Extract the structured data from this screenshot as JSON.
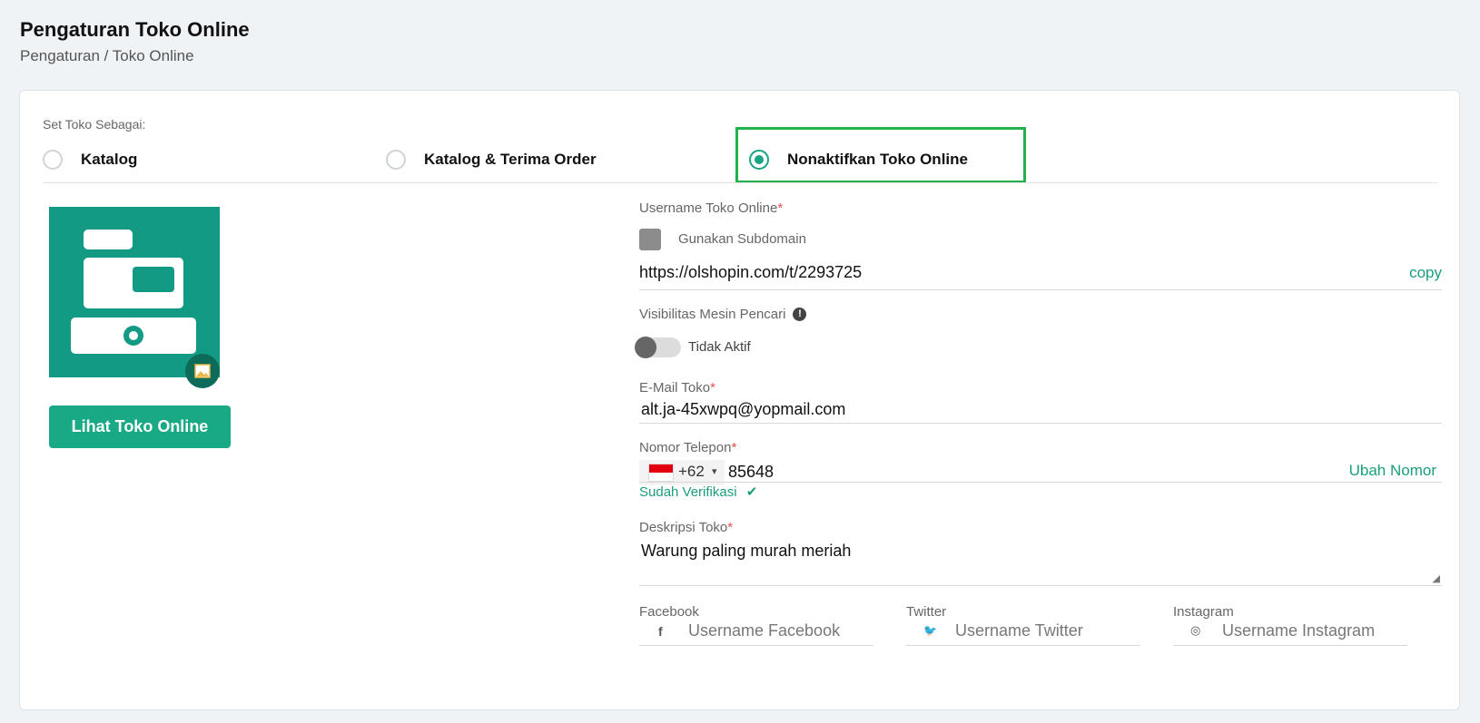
{
  "header": {
    "title": "Pengaturan Toko Online",
    "breadcrumb": "Pengaturan / Toko Online"
  },
  "store_mode": {
    "label": "Set Toko Sebagai:",
    "options": [
      {
        "label": "Katalog",
        "checked": false
      },
      {
        "label": "Katalog & Terima Order",
        "checked": false
      },
      {
        "label": "Nonaktifkan Toko Online",
        "checked": true
      }
    ],
    "highlight_color": "#22b14c"
  },
  "logo": {
    "badge_icon": "image-icon",
    "brand_color": "#139a84"
  },
  "view_button": {
    "label": "Lihat Toko Online",
    "color": "#1aa985"
  },
  "username": {
    "label": "Username Toko Online",
    "required_mark": "*",
    "subdomain_label": "Gunakan Subdomain",
    "url": "https://olshopin.com/t/2293725",
    "copy_label": "copy"
  },
  "visibility": {
    "label": "Visibilitas Mesin Pencari",
    "info_icon": "exclamation-circle-icon",
    "status": "Tidak Aktif"
  },
  "email": {
    "label": "E-Mail Toko",
    "required_mark": "*",
    "value": "alt.ja-45xwpq@yopmail.com"
  },
  "phone": {
    "label": "Nomor Telepon",
    "required_mark": "*",
    "country_code": "+62",
    "dropdown_glyph": "▾",
    "value": "85648",
    "change_label": "Ubah Nomor",
    "verified_label": "Sudah Verifikasi",
    "verified_glyph": "✔"
  },
  "description": {
    "label": "Deskripsi Toko",
    "required_mark": "*",
    "value": "Warung paling murah meriah"
  },
  "social": {
    "facebook": {
      "label": "Facebook",
      "icon_glyph": "f",
      "placeholder": "Username Facebook"
    },
    "twitter": {
      "label": "Twitter",
      "icon_glyph": "🐦",
      "placeholder": "Username Twitter"
    },
    "instagram": {
      "label": "Instagram",
      "icon_glyph": "◎",
      "placeholder": "Username Instagram"
    }
  },
  "colors": {
    "accent": "#1a9e7d",
    "required": "#d9534f"
  }
}
